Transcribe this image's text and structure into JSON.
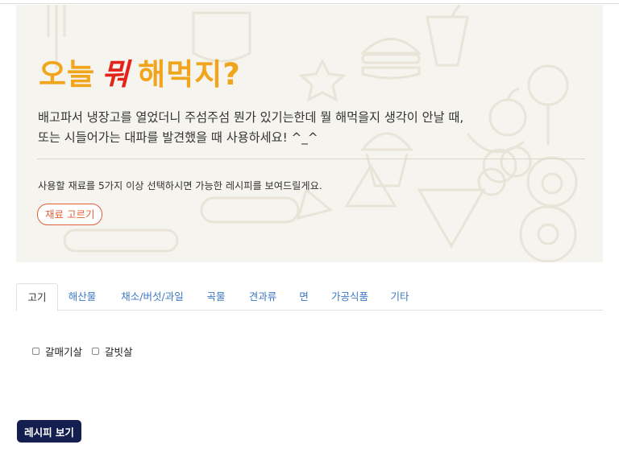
{
  "hero": {
    "title_start": "오늘",
    "title_accent": "뭐",
    "title_end": "해먹지?",
    "description_line1": "배고파서 냉장고를 열었더니 주섬주섬 뭔가 있기는한데 뭘 해먹을지 생각이 안날 때,",
    "description_line2": "또는 시들어가는 대파를 발견했을 때 사용하세요! ^_^",
    "note": "사용할 재료를 5가지 이상 선택하시면 가능한 레시피를 보여드릴게요.",
    "pick_button_label": "재료 고르기",
    "colors": {
      "title": "#f0a51c",
      "accent": "#e2231a",
      "button": "#e0603a"
    },
    "background_icons": [
      "burger-icon",
      "lollipop-icon",
      "apple-icon",
      "watermelon-icon",
      "cupcake-icon",
      "egg-icon",
      "donut-icon",
      "pizza-icon",
      "hotdog-icon",
      "drink-icon",
      "star-icon"
    ]
  },
  "tabs": [
    {
      "label": "고기",
      "active": true
    },
    {
      "label": "해산물",
      "active": false
    },
    {
      "label": "채소/버섯/과일",
      "active": false
    },
    {
      "label": "곡물",
      "active": false
    },
    {
      "label": "견과류",
      "active": false
    },
    {
      "label": "면",
      "active": false
    },
    {
      "label": "가공식품",
      "active": false
    },
    {
      "label": "기타",
      "active": false
    }
  ],
  "ingredients": [
    {
      "label": "갈매기살",
      "checked": false
    },
    {
      "label": "갈빗살",
      "checked": false
    }
  ],
  "view_button_label": "레시피 보기",
  "view_button_color": "#141f4f"
}
